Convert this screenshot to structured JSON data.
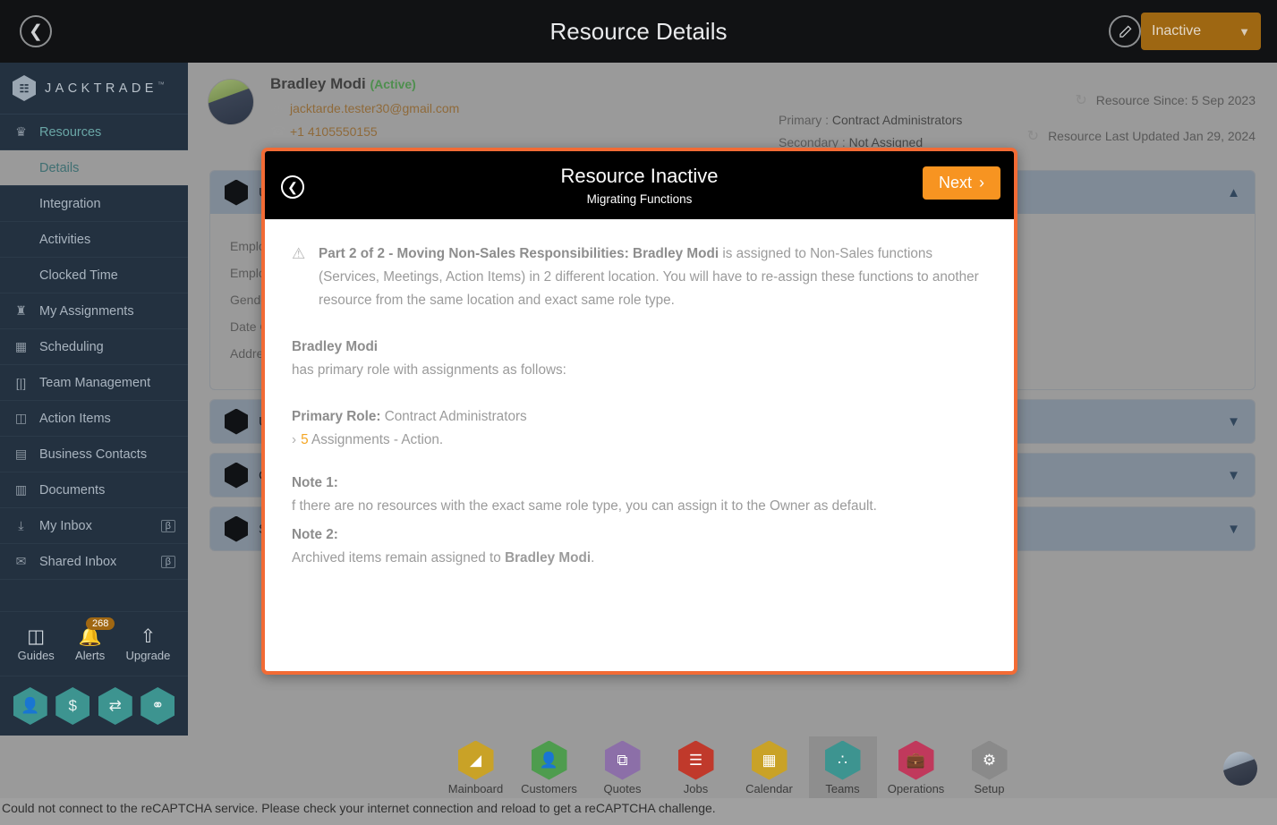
{
  "topbar": {
    "back_icon": "chevron-left-icon",
    "title": "Resource Details",
    "edit_icon": "pencil-icon",
    "status_value": "Inactive",
    "caret": "⌄"
  },
  "sidebar": {
    "brand": {
      "name": "JACKTRADE",
      "tm": "™",
      "mark": "\u0001"
    },
    "items": [
      {
        "label": "Resources",
        "icon": "resources-icon",
        "glyph": "♟",
        "group": true
      },
      {
        "label": "Details",
        "icon": "details-icon",
        "sub": true,
        "active": true
      },
      {
        "label": "Integration",
        "icon": "integration-icon",
        "sub": true
      },
      {
        "label": "Activities",
        "icon": "activities-icon",
        "sub": true
      },
      {
        "label": "Clocked Time",
        "icon": "clock-icon",
        "sub": true
      },
      {
        "label": "My Assignments",
        "icon": "assignments-icon",
        "glyph": "♛"
      },
      {
        "label": "Scheduling",
        "icon": "calendar-clock-icon",
        "glyph": "Ὄ5"
      },
      {
        "label": "Team Management",
        "icon": "team-icon",
        "glyph": "[|]"
      },
      {
        "label": "Action Items",
        "icon": "clipboard-icon",
        "glyph": "ὌB"
      },
      {
        "label": "Business Contacts",
        "icon": "contact-card-icon",
        "glyph": "▤"
      },
      {
        "label": "Documents",
        "icon": "document-icon",
        "glyph": "▥"
      },
      {
        "label": "My Inbox",
        "icon": "inbox-download-icon",
        "glyph": "⤓",
        "beta": "β"
      },
      {
        "label": "Shared Inbox",
        "icon": "envelope-icon",
        "glyph": "✉",
        "beta": "β"
      }
    ],
    "quick": [
      {
        "label": "Guides",
        "icon": "book-icon",
        "glyph": "◫"
      },
      {
        "label": "Alerts",
        "icon": "bell-icon",
        "glyph": "ὑ4",
        "badge": "268"
      },
      {
        "label": "Upgrade",
        "icon": "arrow-up-icon",
        "glyph": "↑"
      }
    ],
    "hex_buttons": [
      {
        "name": "profile-hex-button",
        "glyph": "὆4"
      },
      {
        "name": "billing-hex-button",
        "glyph": "$"
      },
      {
        "name": "payments-hex-button",
        "glyph": "⇄"
      },
      {
        "name": "workflow-hex-button",
        "glyph": "⚭"
      }
    ]
  },
  "resource": {
    "name": "Bradley Modi",
    "status_tag": "(Active)",
    "email_icon": "at-icon",
    "email": "jacktarde.tester30@gmail.com",
    "phone_icon": "phone-icon",
    "phone": "+1 4105550155",
    "primary_label": "Primary :",
    "primary_value": "Contract Administrators",
    "secondary_label": "Secondary :",
    "secondary_value": "Not Assigned",
    "since": "Resource Since: 5 Sep 2023",
    "updated": "Resource Last Updated Jan 29, 2024",
    "refresh_icon": "refresh-icon"
  },
  "panels": [
    {
      "title": "User Information",
      "expanded": true,
      "chevron": "chevron-up-icon",
      "fields": [
        {
          "label": "Employee ID",
          "value": ""
        },
        {
          "label": "Employee Type",
          "value": ""
        },
        {
          "label": "Gender",
          "value": ""
        },
        {
          "label": "Date Of Birth",
          "value": ""
        },
        {
          "label": "Address",
          "value": ""
        }
      ]
    },
    {
      "title": "User Access",
      "expanded": false,
      "chevron": "chevron-down-icon",
      "fields": []
    },
    {
      "title": "Company Information",
      "expanded": false,
      "chevron": "chevron-down-icon",
      "fields": []
    },
    {
      "title": "Settings",
      "expanded": false,
      "chevron": "chevron-down-icon",
      "fields": []
    }
  ],
  "modal": {
    "back_icon": "chevron-left-circle-icon",
    "title": "Resource Inactive",
    "subtitle": "Migrating Functions",
    "next_label": "Next",
    "next_chevron": "›",
    "warning_icon": "warning-triangle-icon",
    "para1_bold": "Part 2 of 2 - Moving Non-Sales Responsibilities: Bradley Modi",
    "para1_rest": " is assigned to Non-Sales functions (Services, Meetings, Action Items) in 2 different location. You will have to re-assign these functions to another resource from the same location and exact same role type.",
    "person_name": "Bradley Modi",
    "person_line": "has primary role with assignments as follows:",
    "primary_role_label": "Primary Role:",
    "primary_role_value": " Contract Administrators",
    "assignment_chevron": "›",
    "assignment_count": "5",
    "assignment_text": " Assignments - Action.",
    "note1_title": "Note 1:",
    "note1_body": "f there are no resources with the exact same role type, you can assign it to the Owner as default.",
    "note2_title": "Note 2:",
    "note2_body_pre": "Archived items remain assigned to ",
    "note2_body_bold": "Bradley Modi",
    "note2_body_post": "."
  },
  "bottomnav": {
    "items": [
      {
        "label": "Mainboard",
        "icon": "mainboard-icon",
        "glyph": "◔",
        "color": "#c9a227",
        "active": false
      },
      {
        "label": "Customers",
        "icon": "customers-icon",
        "glyph": "὆4",
        "color": "#4e9c4e",
        "active": false
      },
      {
        "label": "Quotes",
        "icon": "quotes-icon",
        "glyph": "⧉",
        "color": "#8c6fa8",
        "active": false
      },
      {
        "label": "Jobs",
        "icon": "jobs-icon",
        "glyph": "☰",
        "color": "#c0392b",
        "active": false
      },
      {
        "label": "Calendar",
        "icon": "calendar-icon",
        "glyph": "▦",
        "color": "#c9a227",
        "active": false
      },
      {
        "label": "Teams",
        "icon": "teams-icon",
        "glyph": "∴",
        "color": "#3d9490",
        "active": true
      },
      {
        "label": "Operations",
        "icon": "operations-icon",
        "glyph": "ὋC",
        "color": "#c0395c",
        "active": false
      },
      {
        "label": "Setup",
        "icon": "setup-icon",
        "glyph": "⚙",
        "color": "#8a8a8a",
        "active": false
      }
    ],
    "avatar": "user-avatar"
  },
  "statusbar": {
    "message": "Could not connect to the reCAPTCHA service. Please check your internet connection and reload to get a reCAPTCHA challenge."
  },
  "colors": {
    "accent_orange": "#f26b35",
    "next_orange": "#f79421",
    "status_amber": "#9e6712",
    "sidebar_bg": "#233140",
    "teal": "#3d9490"
  }
}
